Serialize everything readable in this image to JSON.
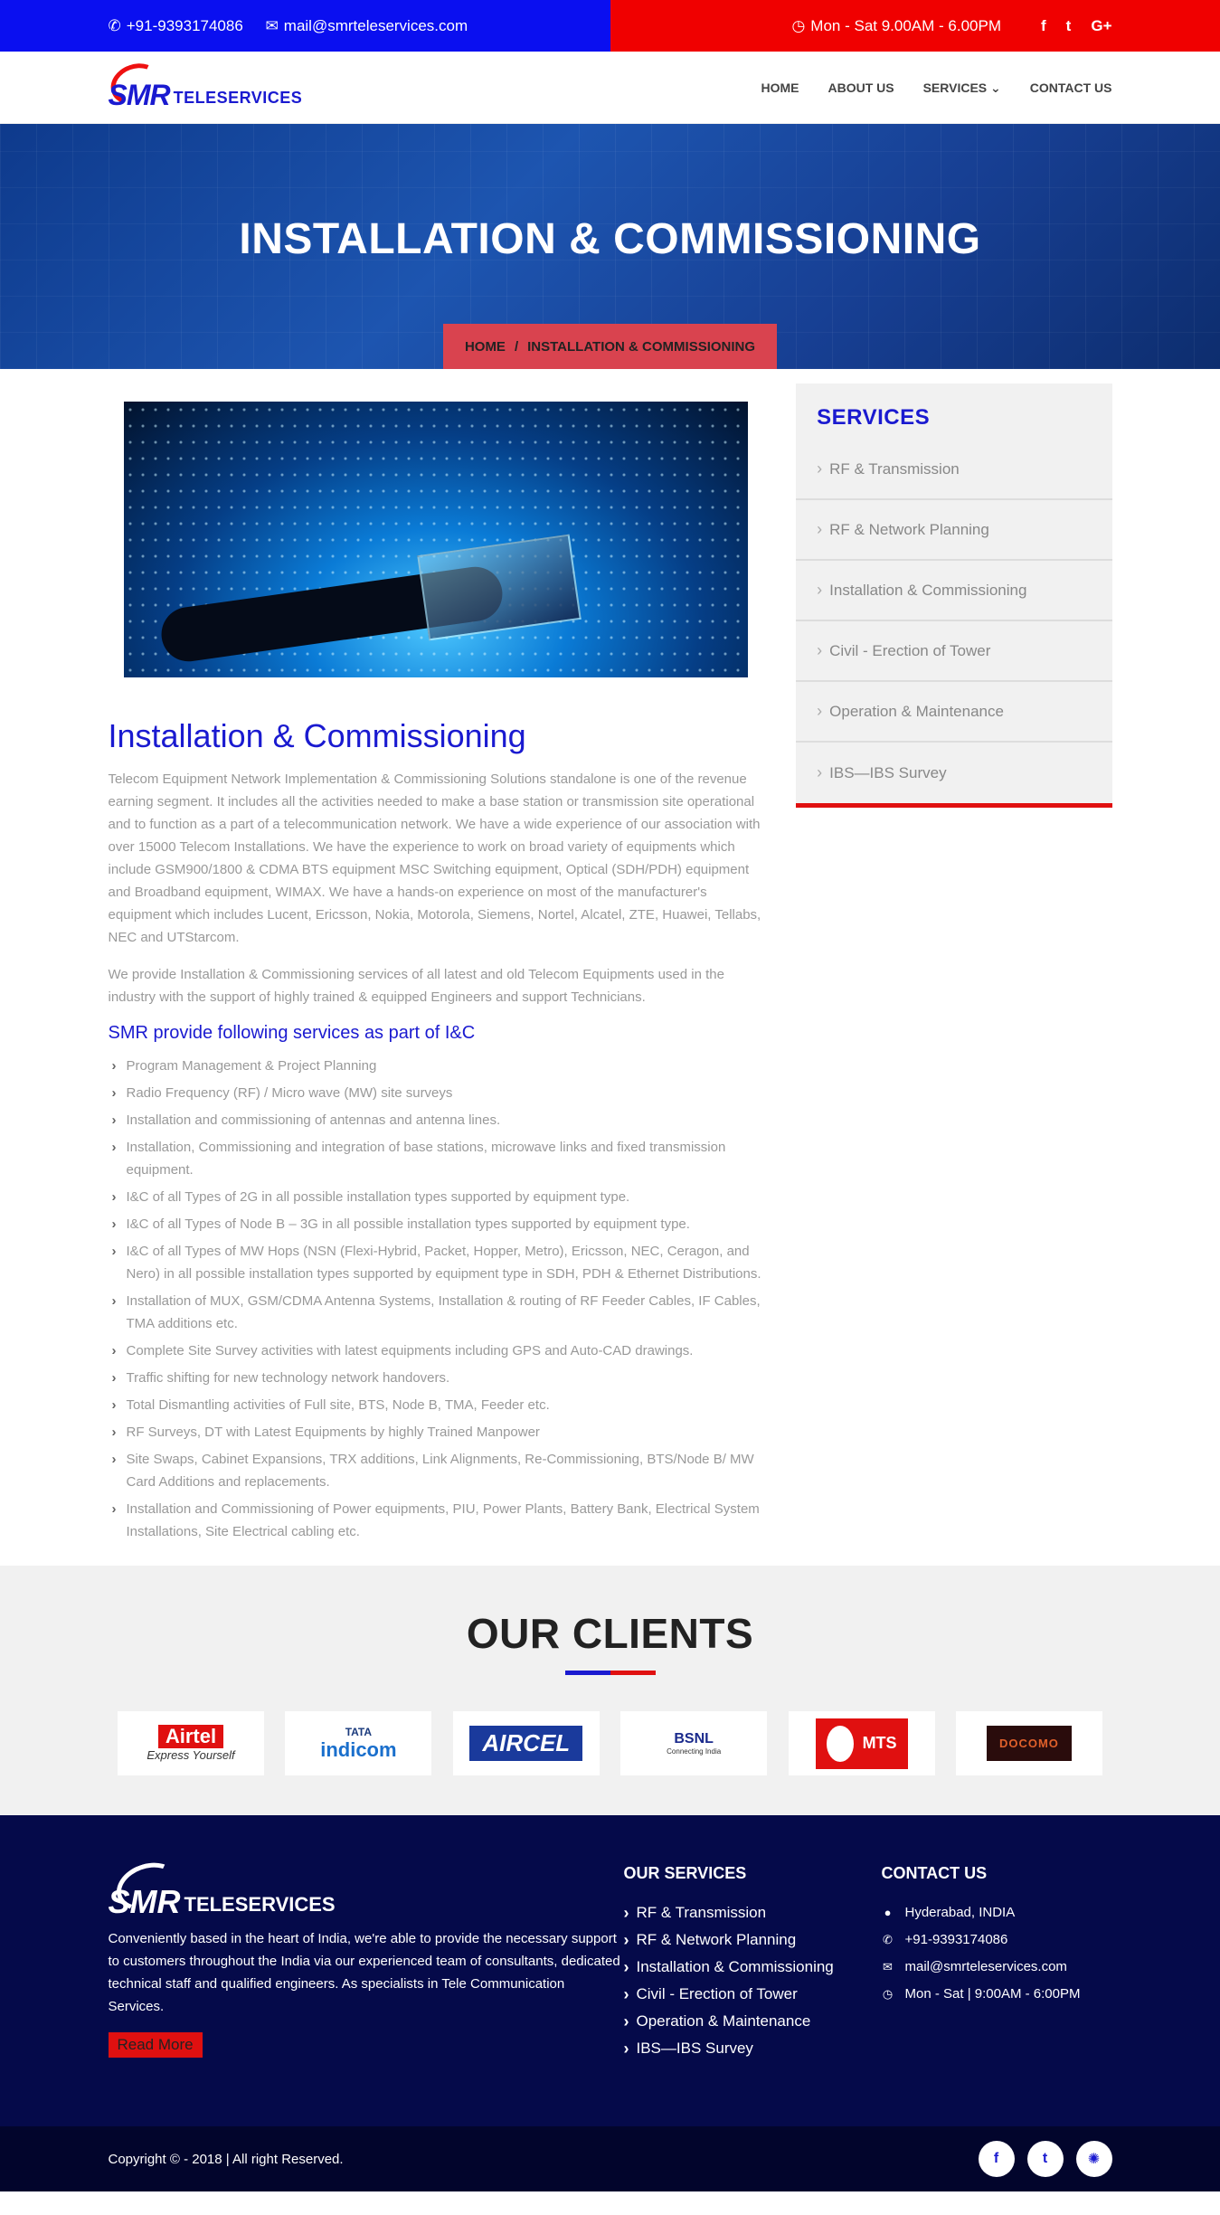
{
  "topbar": {
    "phone": "+91-9393174086",
    "email": "mail@smrteleservices.com",
    "hours": "Mon - Sat 9.00AM - 6.00PM",
    "social": [
      "f",
      "t",
      "G+"
    ]
  },
  "header": {
    "logo_smr": "SMR",
    "logo_tele": "TELESERVICES",
    "nav": [
      "HOME",
      "ABOUT US",
      "SERVICES",
      "CONTACT US"
    ],
    "nav_services_caret": "⌄"
  },
  "hero": {
    "title": "INSTALLATION & COMMISSIONING",
    "breadcrumb_home": "HOME",
    "breadcrumb_sep": "/",
    "breadcrumb_current": "INSTALLATION & COMMISSIONING"
  },
  "content": {
    "heading": "Installation & Commissioning",
    "para1": "Telecom Equipment Network Implementation & Commissioning Solutions standalone is one of the revenue earning segment. It includes all the activities needed to make a base station or transmission site operational and to function as a part of a telecommunication network. We have a wide experience of our association with over 15000 Telecom Installations. We have the experience to work on broad variety of equipments which include GSM900/1800 & CDMA BTS equipment MSC Switching equipment, Optical (SDH/PDH) equipment and Broadband equipment, WIMAX. We have a hands-on experience on most of the manufacturer's equipment which includes Lucent, Ericsson, Nokia, Motorola, Siemens, Nortel, Alcatel, ZTE, Huawei, Tellabs, NEC and UTStarcom.",
    "para2": "We provide Installation & Commissioning services of all latest and old Telecom Equipments used in the industry with the support of highly trained & equipped Engineers and support Technicians.",
    "subheading": "SMR provide following services as part of I&C",
    "services": [
      "Program Management & Project Planning",
      "Radio Frequency (RF) / Micro wave (MW) site surveys",
      "Installation and commissioning of antennas and antenna lines.",
      "Installation, Commissioning and integration of base stations, microwave links and fixed transmission equipment.",
      "I&C of all Types of 2G in all possible installation types supported by equipment type.",
      "I&C of all Types of Node B – 3G in all possible installation types supported by equipment type.",
      "I&C of all Types of MW Hops (NSN (Flexi-Hybrid, Packet, Hopper, Metro), Ericsson, NEC, Ceragon, and Nero) in all possible installation types supported by equipment type in SDH, PDH & Ethernet Distributions.",
      "Installation of MUX, GSM/CDMA Antenna Systems, Installation & routing of RF Feeder Cables, IF Cables, TMA additions etc.",
      "Complete Site Survey activities with latest equipments including GPS and Auto-CAD drawings.",
      "Traffic shifting for new technology network handovers.",
      "Total Dismantling activities of Full site, BTS, Node B, TMA, Feeder etc.",
      "RF Surveys, DT with Latest Equipments by highly Trained Manpower",
      "Site Swaps, Cabinet Expansions, TRX additions, Link Alignments, Re-Commissioning, BTS/Node B/ MW Card Additions and replacements.",
      "Installation and Commissioning of Power equipments, PIU, Power Plants, Battery Bank, Electrical System Installations, Site Electrical cabling etc."
    ]
  },
  "sidebar": {
    "title": "SERVICES",
    "items": [
      "RF & Transmission",
      "RF & Network Planning",
      "Installation & Commissioning",
      "Civil - Erection of Tower",
      "Operation & Maintenance",
      "IBS—IBS Survey"
    ]
  },
  "clients": {
    "title": "OUR CLIENTS",
    "airtel_brand": "Airtel",
    "airtel_tag": "Express Yourself",
    "tata_top": "TATA",
    "tata_brand": "indicom",
    "aircel": "AIRCEL",
    "bsnl": "BSNL",
    "bsnl_tag": "Connecting India",
    "mts": "MTS",
    "docomo": "DOCOMO"
  },
  "footer": {
    "logo_smr": "SMR",
    "logo_tele": "TELESERVICES",
    "about": "Conveniently based in the heart of India, we're able to provide the necessary support to customers throughout the India via our experienced team of consultants, dedicated technical staff and qualified engineers. As specialists in Tele Communication Services.",
    "read_more": "Read More",
    "services_title": "OUR SERVICES",
    "services": [
      "RF & Transmission",
      "RF & Network Planning",
      "Installation & Commissioning",
      "Civil - Erection of Tower",
      "Operation & Maintenance",
      "IBS—IBS Survey"
    ],
    "contact_title": "CONTACT US",
    "location": "Hyderabad, INDIA",
    "phone": "+91-9393174086",
    "email": "mail@smrteleservices.com",
    "hours": "Mon - Sat | 9:00AM - 6:00PM"
  },
  "bottom": {
    "copyright": "Copyright © - 2018 | All right Reserved.",
    "social": [
      "f",
      "t",
      "✺"
    ]
  }
}
